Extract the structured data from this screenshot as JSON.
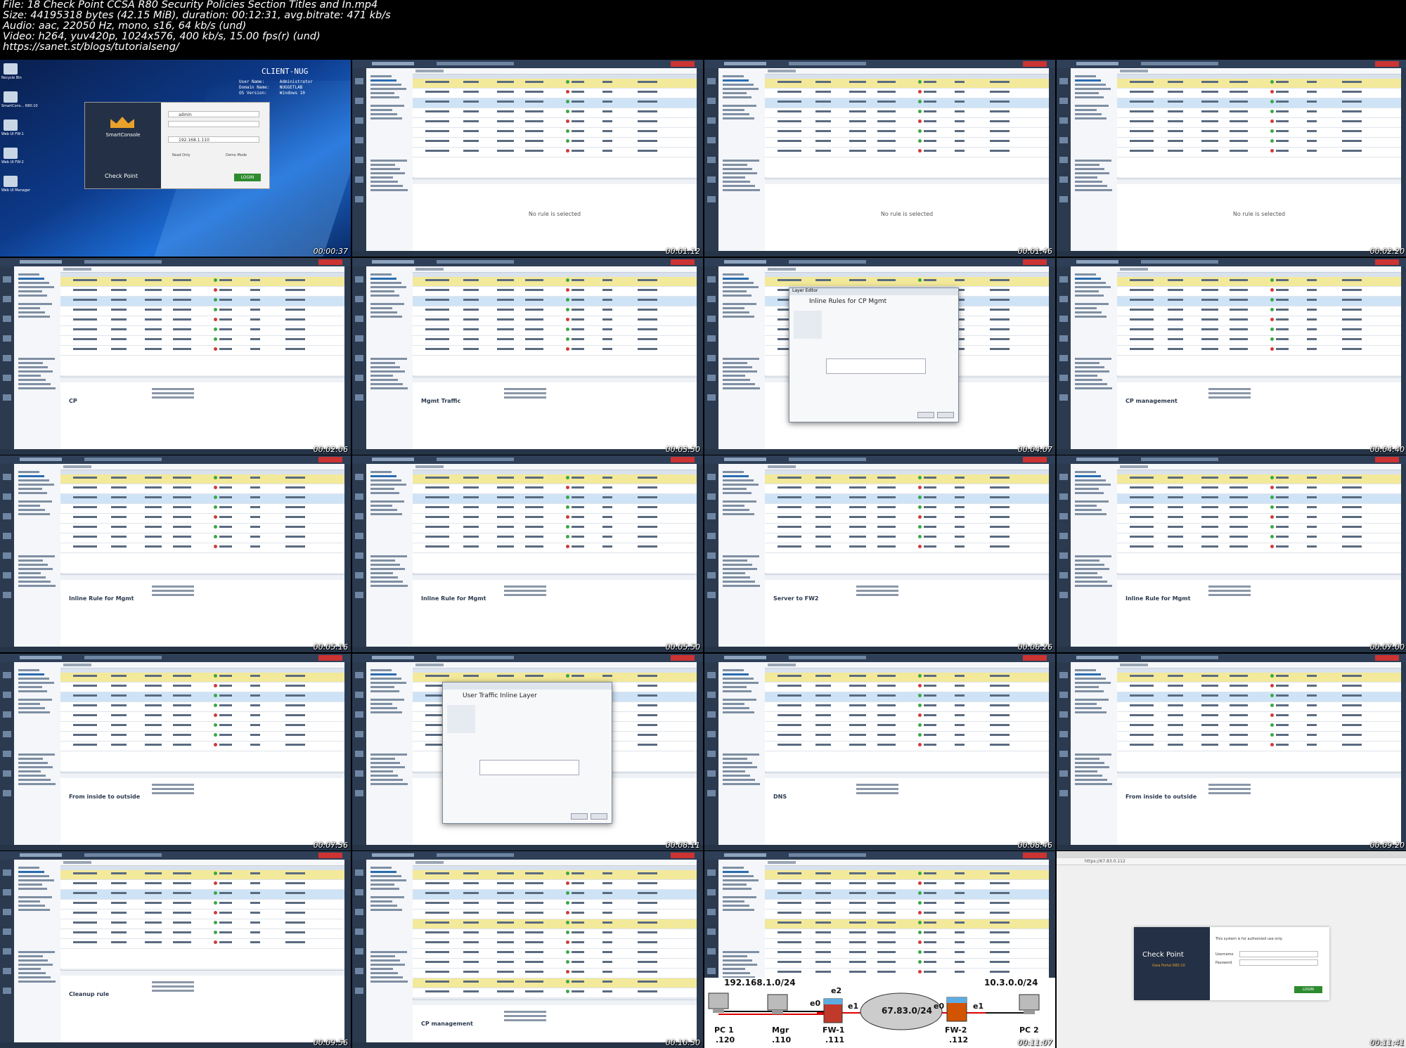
{
  "header": {
    "lines": [
      "File: 18 Check Point CCSA R80 Security Policies Section Titles and In.mp4",
      "Size: 44195318 bytes (42.15 MiB), duration: 00:12:31, avg.bitrate: 471 kb/s",
      "Audio: aac, 22050 Hz, mono, s16, 64 kb/s (und)",
      "Video: h264, yuv420p, 1024x576, 400 kb/s, 15.00 fps(r) (und)",
      "https://sanet.st/blogs/tutorialseng/"
    ]
  },
  "timestamps": [
    "00:00:37",
    "00:01:12",
    "00:01:46",
    "00:02:20",
    "00:02:06",
    "00:03:30",
    "00:04:07",
    "00:04:40",
    "00:05:16",
    "00:05:50",
    "00:06:26",
    "00:07:00",
    "00:07:36",
    "00:08:11",
    "00:08:46",
    "00:09:20",
    "00:09:56",
    "00:10:30",
    "00:11:07",
    "00:11:41"
  ],
  "desktop": {
    "client_name": "CLIENT-NUG",
    "info": "User Name:      Administrator\nDomain Name:    NUGGETLAB\nOS Version:     Windows 10",
    "login_user": "admin",
    "login_server": "192.168.1.110",
    "read_only": "Read Only",
    "demo_mode": "Demo Mode",
    "login_button": "LOGIN",
    "brand": "SmartConsole",
    "vendor": "Check Point",
    "icons": [
      "Recycle Bin",
      "SmartCons... R80.10",
      "Web UI FW-1",
      "Web UI FW-2",
      "Web UI Manager"
    ]
  },
  "smartconsole": {
    "no_rule": "No rule is selected",
    "details": [
      {
        "frame": 4,
        "title": "CP"
      },
      {
        "frame": 5,
        "title": "Mgmt Traffic"
      },
      {
        "frame": 7,
        "title": "CP management"
      },
      {
        "frame": 8,
        "title": "Inline Rule for Mgmt"
      },
      {
        "frame": 9,
        "title": "Inline Rule for Mgmt"
      },
      {
        "frame": 10,
        "title": "Server to FW2"
      },
      {
        "frame": 11,
        "title": "Inline Rule for Mgmt"
      },
      {
        "frame": 12,
        "title": "From inside to outside"
      },
      {
        "frame": 14,
        "title": "DNS"
      },
      {
        "frame": 15,
        "title": "From inside to outside"
      },
      {
        "frame": 16,
        "title": "Cleanup rule"
      },
      {
        "frame": 17,
        "title": "CP management"
      }
    ]
  },
  "dialogs": {
    "layer1_title": "Layer Editor",
    "layer1_name": "Inline Rules for CP Mgmt",
    "layer2_name": "User Traffic Inline Layer"
  },
  "diagram": {
    "net1": "192.168.1.0/24",
    "net2": "67.83.0/24",
    "net3": "10.3.0.0/24",
    "pc1": "PC 1",
    "pc1_ip": ".120",
    "mgr": "Mgr",
    "mgr_ip": ".110",
    "fw1": "FW-1",
    "fw1_ip": ".111",
    "fw2": "FW-2",
    "fw2_ip": ".112",
    "pc2": "PC 2",
    "e0a": "e0",
    "e1a": "e1",
    "e2a": "e2",
    "e0b": "e0",
    "e1b": "e1"
  },
  "browser": {
    "url": "https://67.83.0.112",
    "message": "This system is for authorized use only.",
    "username": "Username",
    "password": "Password",
    "login": "LOGIN",
    "vendor": "Check Point",
    "product": "Gaia Portal R80.10"
  },
  "colors": {
    "accent_green": "#39a845",
    "drop_red": "#d23a3a",
    "section_yellow": "#f3e99a",
    "selection_blue": "#cfe3f7"
  }
}
